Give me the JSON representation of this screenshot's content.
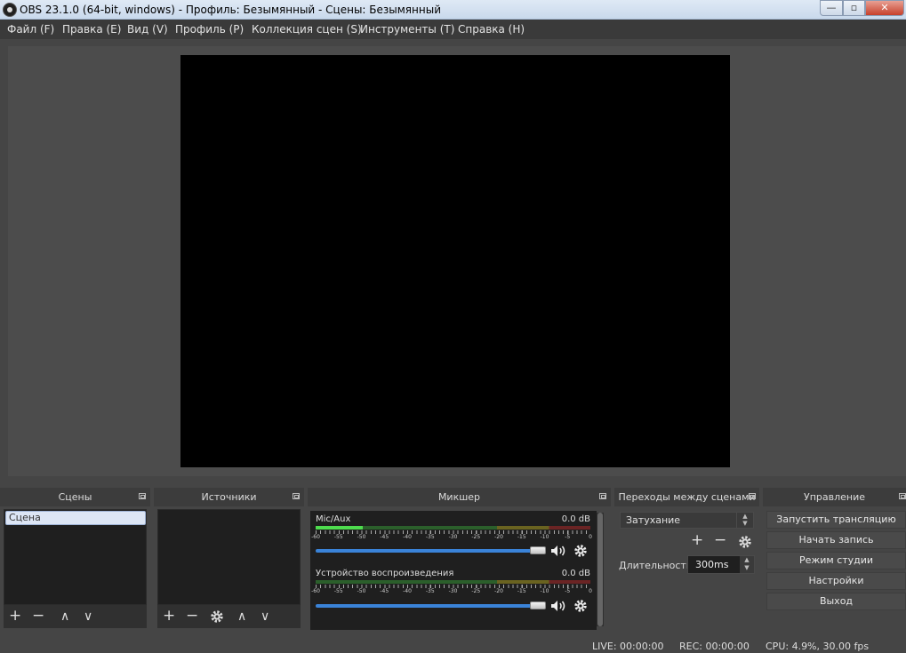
{
  "window": {
    "title": "OBS 23.1.0 (64-bit, windows) - Профиль: Безымянный - Сцены: Безымянный",
    "min_glyph": "—",
    "max_glyph": "▫",
    "close_glyph": "✕"
  },
  "menu": [
    "Файл (F)",
    "Правка (E)",
    "Вид (V)",
    "Профиль (P)",
    "Коллекция сцен (S)",
    "Инструменты (T)",
    "Справка (H)"
  ],
  "docks": {
    "scenes": {
      "title": "Сцены",
      "items": [
        "Сцена"
      ],
      "tools": {
        "add": "+",
        "remove": "−",
        "up": "∧",
        "down": "∨"
      }
    },
    "sources": {
      "title": "Источники",
      "tools": {
        "add": "+",
        "remove": "−",
        "up": "∧",
        "down": "∨"
      }
    },
    "mixer": {
      "title": "Микшер",
      "scale": [
        "-60",
        "-55",
        "-50",
        "-45",
        "-40",
        "-35",
        "-30",
        "-25",
        "-20",
        "-15",
        "-10",
        "-5",
        "0"
      ],
      "channels": [
        {
          "name": "Mic/Aux",
          "db": "0.0 dB",
          "level": 0.17
        },
        {
          "name": "Устройство воспроизведения",
          "db": "0.0 dB",
          "level": 0
        }
      ]
    },
    "transitions": {
      "title": "Переходы между сценами",
      "selected": "Затухание",
      "add": "+",
      "remove": "−",
      "duration_label": "Длительность",
      "duration_value": "300ms"
    },
    "controls": {
      "title": "Управление",
      "buttons": [
        "Запустить трансляцию",
        "Начать запись",
        "Режим студии",
        "Настройки",
        "Выход"
      ]
    }
  },
  "status": {
    "live": "LIVE: 00:00:00",
    "rec": "REC: 00:00:00",
    "cpu": "CPU: 4.9%, 30.00 fps"
  },
  "colors": {
    "accent": "#3a83d8",
    "meter_green": "#4edc4e",
    "panel_bg": "#1f1f1f"
  }
}
